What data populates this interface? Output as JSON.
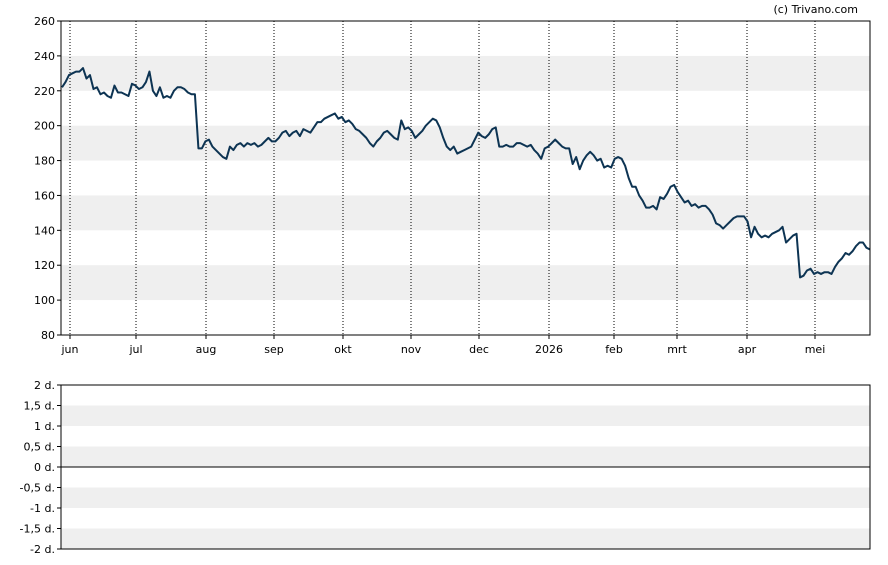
{
  "credit": "(c) Trivano.com",
  "colors": {
    "line": "#0d3453",
    "band": "#efefef",
    "border": "#000000"
  },
  "chart_data": [
    {
      "type": "line",
      "ylim": [
        80,
        260
      ],
      "y_ticks": [
        "80",
        "100",
        "120",
        "140",
        "160",
        "180",
        "200",
        "220",
        "240",
        "260"
      ],
      "x_tick_labels": [
        "jun",
        "jul",
        "aug",
        "sep",
        "okt",
        "nov",
        "dec",
        "2026",
        "feb",
        "mrt",
        "apr",
        "mei"
      ],
      "grid": "vertical dotted at month starts, alternating horizontal bands",
      "series": [
        {
          "values": [
            222,
            225,
            229,
            230,
            231,
            231,
            233,
            227,
            229,
            221,
            222,
            218,
            219,
            217,
            216,
            223,
            219,
            219,
            218,
            217,
            224,
            223,
            221,
            222,
            225,
            231,
            220,
            217,
            222,
            216,
            217,
            216,
            220,
            222,
            222,
            221,
            219,
            218,
            218,
            187,
            187,
            191,
            192,
            188,
            186,
            184,
            182,
            181,
            188,
            186,
            189,
            190,
            188,
            190,
            189,
            190,
            188,
            189,
            191,
            193,
            191,
            191,
            193,
            196,
            197,
            194,
            196,
            197,
            194,
            198,
            197,
            196,
            199,
            202,
            202,
            204,
            205,
            206,
            207,
            204,
            205,
            202,
            203,
            201,
            198,
            197,
            195,
            193,
            190,
            188,
            191,
            193,
            196,
            197,
            195,
            193,
            192,
            203,
            198,
            199,
            197,
            193,
            195,
            197,
            200,
            202,
            204,
            203,
            199,
            193,
            188,
            186,
            188,
            184,
            185,
            186,
            187,
            188,
            192,
            196,
            194,
            193,
            195,
            198,
            199,
            188,
            188,
            189,
            188,
            188,
            190,
            190,
            189,
            188,
            189,
            186,
            184,
            181,
            187,
            188,
            190,
            192,
            190,
            188,
            187,
            187,
            178,
            182,
            175,
            180,
            183,
            185,
            183,
            180,
            181,
            176,
            177,
            176,
            181,
            182,
            181,
            177,
            170,
            165,
            165,
            160,
            157,
            153,
            153,
            154,
            152,
            159,
            158,
            161,
            165,
            166,
            162,
            159,
            156,
            157,
            154,
            155,
            153,
            154,
            154,
            152,
            149,
            144,
            143,
            141,
            143,
            145,
            147,
            148,
            148,
            148,
            145,
            136,
            142,
            138,
            136,
            137,
            136,
            138,
            139,
            140,
            142,
            133,
            135,
            137,
            138,
            113,
            114,
            117,
            118,
            115,
            116,
            115,
            116,
            116,
            115,
            119,
            122,
            124,
            127,
            126,
            128,
            131,
            133,
            133,
            130,
            129
          ]
        }
      ]
    },
    {
      "type": "line",
      "ylim": [
        -2,
        2
      ],
      "y_ticks": [
        "2 d.",
        "1,5 d.",
        "1 d.",
        "0,5 d.",
        "0 d.",
        "-0,5 d.",
        "-1 d.",
        "-1,5 d.",
        "-2 d."
      ],
      "grid": "alternating horizontal bands, zero line",
      "series": []
    }
  ]
}
